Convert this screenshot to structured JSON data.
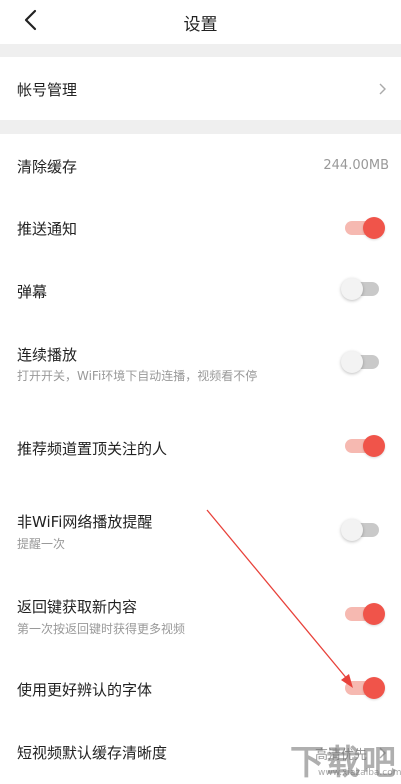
{
  "header": {
    "title": "设置",
    "back_icon": "chevron-left-icon"
  },
  "account": {
    "label": "帐号管理",
    "icon": "chevron-right-icon"
  },
  "cache": {
    "label": "清除缓存",
    "value": "244.00MB"
  },
  "push": {
    "label": "推送通知",
    "on": true
  },
  "danmu": {
    "label": "弹幕",
    "on": false
  },
  "autoplay": {
    "label": "连续播放",
    "desc": "打开开关，WiFi环境下自动连播，视频看不停",
    "on": false
  },
  "pin": {
    "label": "推荐频道置顶关注的人",
    "on": true
  },
  "nonwifi": {
    "label": "非WiFi网络播放提醒",
    "desc": "提醒一次",
    "on": false
  },
  "backkey": {
    "label": "返回键获取新内容",
    "desc": "第一次按返回键时获得更多视频",
    "on": true
  },
  "font": {
    "label": "使用更好辨认的字体",
    "on": true
  },
  "quality": {
    "label": "短视频默认缓存清晰度",
    "value": "高清优先"
  },
  "colors": {
    "accent": "#f0544a",
    "accent_track": "#f6b9b1",
    "off_track": "#c9c9c9",
    "annotation": "#e8413a"
  },
  "watermark": {
    "text": "下载吧",
    "sub": "www.xiazaiba.com"
  }
}
